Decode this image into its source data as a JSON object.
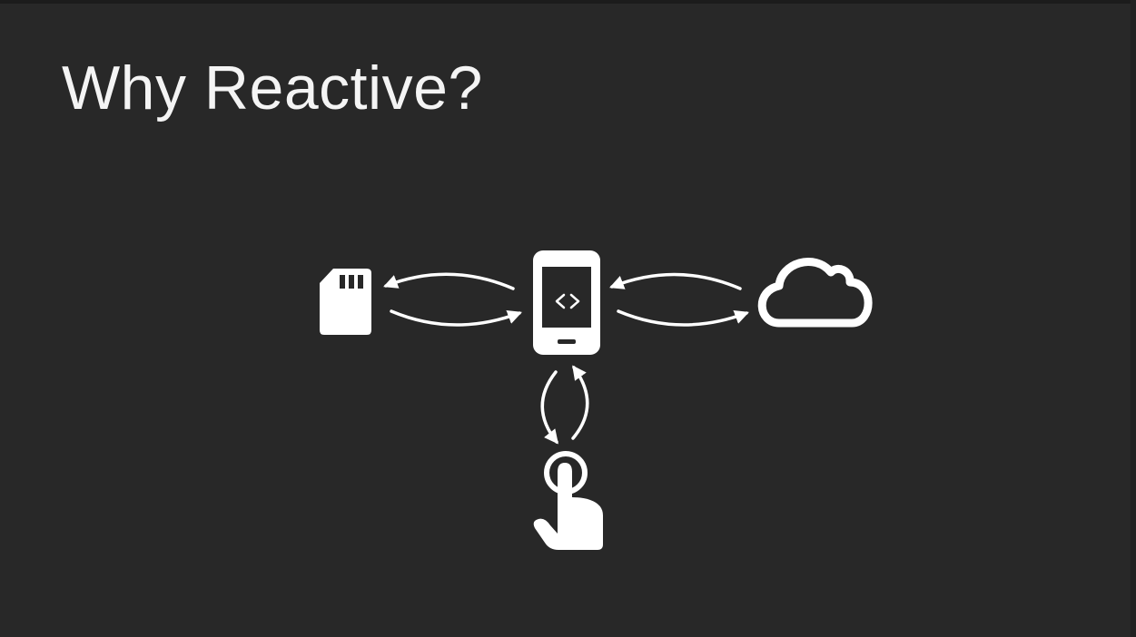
{
  "slide": {
    "title": "Why Reactive?"
  },
  "diagram": {
    "center": {
      "icon": "smartphone-code-icon"
    },
    "nodes": [
      {
        "icon": "sd-card-icon"
      },
      {
        "icon": "cloud-icon"
      },
      {
        "icon": "touch-hand-icon"
      }
    ],
    "colors": {
      "background": "#282828",
      "foreground": "#ffffff"
    }
  }
}
